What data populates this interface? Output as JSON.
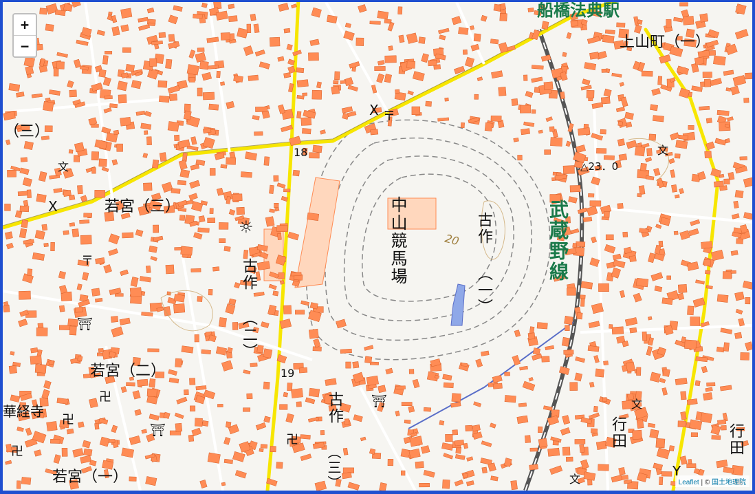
{
  "map": {
    "zoom_in": "+",
    "zoom_out": "−",
    "attribution_leaflet": "Leaflet",
    "attribution_sep": " | © ",
    "attribution_gsi": "国土地理院",
    "labels": {
      "funabashi_hoten_station": "船橋法典駅",
      "kamiyama_1": "上山町（一）",
      "wakamiya_3_left": "（三）",
      "wakamiya_3": "若宮（三）",
      "wakamiya_2": "若宮（二）",
      "wakamiya_1": "若宮（一）",
      "kengyoji": "華経寺",
      "kosaku_left": "古作",
      "kosaku_left_2": "（二）",
      "kosaku_right": "古作",
      "kosaku_right_1": "（一）",
      "kosaku_bottom": "古作",
      "kosaku_bottom_3": "（三）",
      "nakayama_racecourse": "中山競馬場",
      "musashino_line": "武蔵野線",
      "gyoda_1": "行田",
      "gyoda_2": "行田",
      "route_18": "18",
      "route_19": "19",
      "elevation": "△23．0",
      "contour_20": "20"
    },
    "colors": {
      "background": "#f6f5f1",
      "building": "#ff8c55",
      "road_major": "#f7e600",
      "road_minor": "#ffffff",
      "railway": "#555555",
      "water": "#8fa8e8",
      "frame": "#1f4fd0"
    },
    "symbols": {
      "school": "文",
      "police": "X",
      "post_office": "〒",
      "shrine": "⛩",
      "temple": "卍",
      "factory": "☼",
      "fire_station": "Y"
    }
  }
}
